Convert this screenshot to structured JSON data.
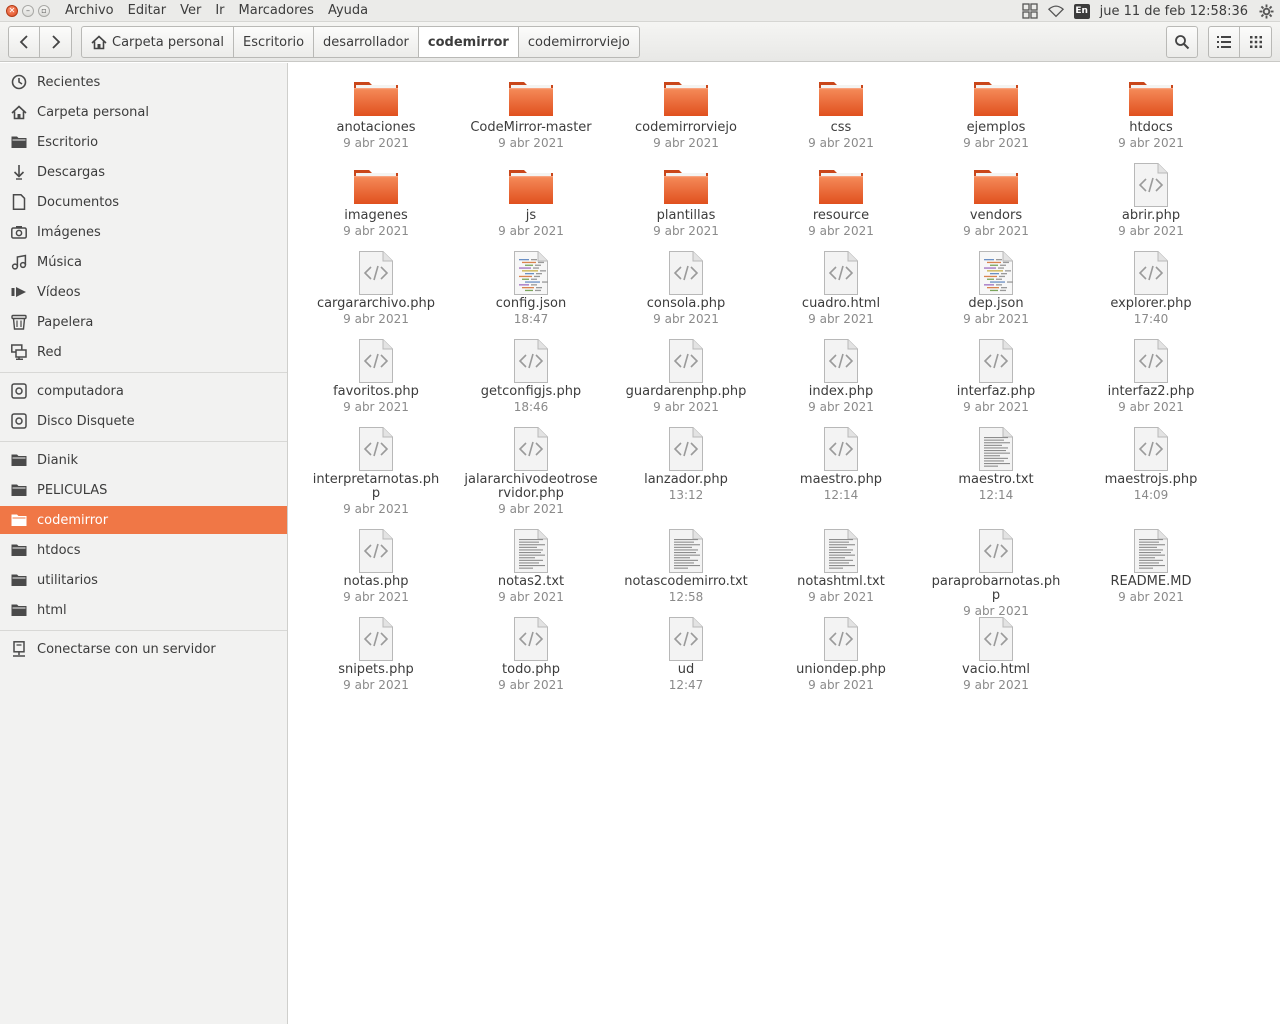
{
  "menubar": {
    "items": [
      "Archivo",
      "Editar",
      "Ver",
      "Ir",
      "Marcadores",
      "Ayuda"
    ],
    "clock": "jue 11 de feb 12:58:36",
    "keyboard_layout": "En"
  },
  "toolbar": {
    "breadcrumbs": [
      "Carpeta personal",
      "Escritorio",
      "desarrollador",
      "codemirror",
      "codemirrorviejo"
    ],
    "active_crumb": "codemirror"
  },
  "sidebar": {
    "places": [
      {
        "label": "Recientes",
        "icon": "clock-icon"
      },
      {
        "label": "Carpeta personal",
        "icon": "home-icon"
      },
      {
        "label": "Escritorio",
        "icon": "folder-icon"
      },
      {
        "label": "Descargas",
        "icon": "download-icon"
      },
      {
        "label": "Documentos",
        "icon": "document-icon"
      },
      {
        "label": "Imágenes",
        "icon": "camera-icon"
      },
      {
        "label": "Música",
        "icon": "music-icon"
      },
      {
        "label": "Vídeos",
        "icon": "video-icon"
      },
      {
        "label": "Papelera",
        "icon": "trash-icon"
      },
      {
        "label": "Red",
        "icon": "network-icon"
      }
    ],
    "devices": [
      {
        "label": "computadora",
        "icon": "drive-icon"
      },
      {
        "label": "Disco Disquete",
        "icon": "drive-icon"
      }
    ],
    "bookmarks": [
      {
        "label": "Dianik",
        "icon": "folder-icon"
      },
      {
        "label": "PELICULAS",
        "icon": "folder-icon"
      },
      {
        "label": "codemirror",
        "icon": "folder-icon",
        "selected": true
      },
      {
        "label": "htdocs",
        "icon": "folder-icon"
      },
      {
        "label": "utilitarios",
        "icon": "folder-icon"
      },
      {
        "label": "html",
        "icon": "folder-icon"
      }
    ],
    "network": [
      {
        "label": "Conectarse con un servidor",
        "icon": "server-icon"
      }
    ]
  },
  "colors": {
    "accent": "#f07746",
    "folder_top": "#f58b5a",
    "folder_bottom": "#e0501e"
  },
  "files": [
    {
      "name": "anotaciones",
      "date": "9 abr 2021",
      "type": "folder"
    },
    {
      "name": "CodeMirror-master",
      "date": "9 abr 2021",
      "type": "folder"
    },
    {
      "name": "codemirrorviejo",
      "date": "9 abr 2021",
      "type": "folder"
    },
    {
      "name": "css",
      "date": "9 abr 2021",
      "type": "folder"
    },
    {
      "name": "ejemplos",
      "date": "9 abr 2021",
      "type": "folder"
    },
    {
      "name": "htdocs",
      "date": "9 abr 2021",
      "type": "folder"
    },
    {
      "name": "imagenes",
      "date": "9 abr 2021",
      "type": "folder"
    },
    {
      "name": "js",
      "date": "9 abr 2021",
      "type": "folder"
    },
    {
      "name": "plantillas",
      "date": "9 abr 2021",
      "type": "folder"
    },
    {
      "name": "resource",
      "date": "9 abr 2021",
      "type": "folder"
    },
    {
      "name": "vendors",
      "date": "9 abr 2021",
      "type": "folder"
    },
    {
      "name": "abrir.php",
      "date": "9 abr 2021",
      "type": "code"
    },
    {
      "name": "cargararchivo.php",
      "date": "9 abr 2021",
      "type": "code"
    },
    {
      "name": "config.json",
      "date": "18:47",
      "type": "json"
    },
    {
      "name": "consola.php",
      "date": "9 abr 2021",
      "type": "code"
    },
    {
      "name": "cuadro.html",
      "date": "9 abr 2021",
      "type": "code"
    },
    {
      "name": "dep.json",
      "date": "9 abr 2021",
      "type": "json"
    },
    {
      "name": "explorer.php",
      "date": "17:40",
      "type": "code"
    },
    {
      "name": "favoritos.php",
      "date": "9 abr 2021",
      "type": "code"
    },
    {
      "name": "getconfigjs.php",
      "date": "18:46",
      "type": "code"
    },
    {
      "name": "guardarenphp.php",
      "date": "9 abr 2021",
      "type": "code"
    },
    {
      "name": "index.php",
      "date": "9 abr 2021",
      "type": "code"
    },
    {
      "name": "interfaz.php",
      "date": "9 abr 2021",
      "type": "code"
    },
    {
      "name": "interfaz2.php",
      "date": "9 abr 2021",
      "type": "code"
    },
    {
      "name": "interpretarnotas.php",
      "date": "9 abr 2021",
      "type": "code"
    },
    {
      "name": "jalararchivodeotroservidor.php",
      "date": "9 abr 2021",
      "type": "code"
    },
    {
      "name": "lanzador.php",
      "date": "13:12",
      "type": "code"
    },
    {
      "name": "maestro.php",
      "date": "12:14",
      "type": "code"
    },
    {
      "name": "maestro.txt",
      "date": "12:14",
      "type": "text"
    },
    {
      "name": "maestrojs.php",
      "date": "14:09",
      "type": "code"
    },
    {
      "name": "notas.php",
      "date": "9 abr 2021",
      "type": "code"
    },
    {
      "name": "notas2.txt",
      "date": "9 abr 2021",
      "type": "text"
    },
    {
      "name": "notascodemirro.txt",
      "date": "12:58",
      "type": "text"
    },
    {
      "name": "notashtml.txt",
      "date": "9 abr 2021",
      "type": "text"
    },
    {
      "name": "paraprobarnotas.php",
      "date": "9 abr 2021",
      "type": "code"
    },
    {
      "name": "README.MD",
      "date": "9 abr 2021",
      "type": "text"
    },
    {
      "name": "snipets.php",
      "date": "9 abr 2021",
      "type": "code"
    },
    {
      "name": "todo.php",
      "date": "9 abr 2021",
      "type": "code"
    },
    {
      "name": "ud",
      "date": "12:47",
      "type": "code"
    },
    {
      "name": "uniondep.php",
      "date": "9 abr 2021",
      "type": "code"
    },
    {
      "name": "vacio.html",
      "date": "9 abr 2021",
      "type": "code"
    }
  ]
}
